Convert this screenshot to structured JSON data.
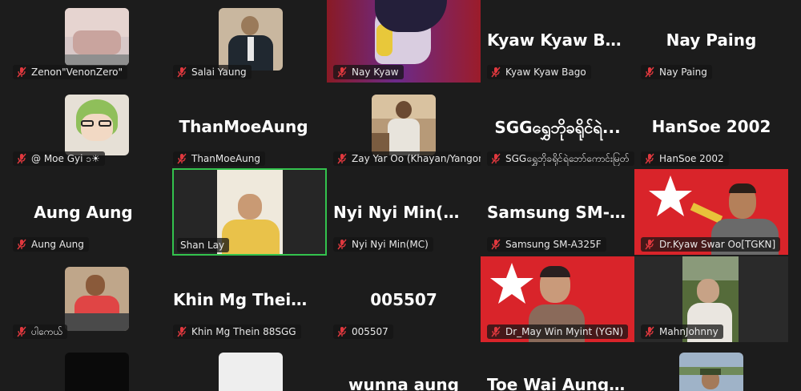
{
  "tiles": [
    {
      "name": "Zenon\"VenonZero\""
    },
    {
      "name": "Salai Yaung"
    },
    {
      "name": "Nay Kyaw"
    },
    {
      "name": "Kyaw Kyaw Bago",
      "display": "Kyaw Kyaw Bago"
    },
    {
      "name": "Nay Paing",
      "display": "Nay Paing"
    },
    {
      "name": "@ Moe Gyi ၁☀"
    },
    {
      "name": "ThanMoeAung",
      "display": "ThanMoeAung"
    },
    {
      "name": "Zay Yar Oo (Khayan/Yangon)"
    },
    {
      "name": "SGGရွှေဘိုခရိုင်ရဲဘော်ကောင်းမြတ်",
      "display": "SGGရွှေဘိုခရိုင်ရဲ..."
    },
    {
      "name": "HanSoe 2002",
      "display": "HanSoe 2002"
    },
    {
      "name": "Aung Aung",
      "display": "Aung Aung"
    },
    {
      "name": "Shan Lay"
    },
    {
      "name": "Nyi Nyi Min(MC)",
      "display": "Nyi Nyi Min(MC)"
    },
    {
      "name": "Samsung SM-A325F",
      "display": "Samsung  SM-A..."
    },
    {
      "name": "Dr.Kyaw Swar Oo[TGKN]"
    },
    {
      "name": "ပါကေယ်"
    },
    {
      "name": "Khin Mg Thein 88SGG",
      "display": "Khin  Mg  Thein..."
    },
    {
      "name": "005507",
      "display": "005507"
    },
    {
      "name": "Dr_May Win Myint (YGN)"
    },
    {
      "name": "MahnJohnny"
    },
    {
      "name": ""
    },
    {
      "name": ""
    },
    {
      "name": "",
      "display": "wunna aung"
    },
    {
      "name": "",
      "display": "Toe  Wai  Aung(..."
    },
    {
      "name": ""
    }
  ],
  "colors": {
    "background": "#1c1c1c",
    "active_border": "#33c24d",
    "mic_muted": "#e0383e"
  }
}
